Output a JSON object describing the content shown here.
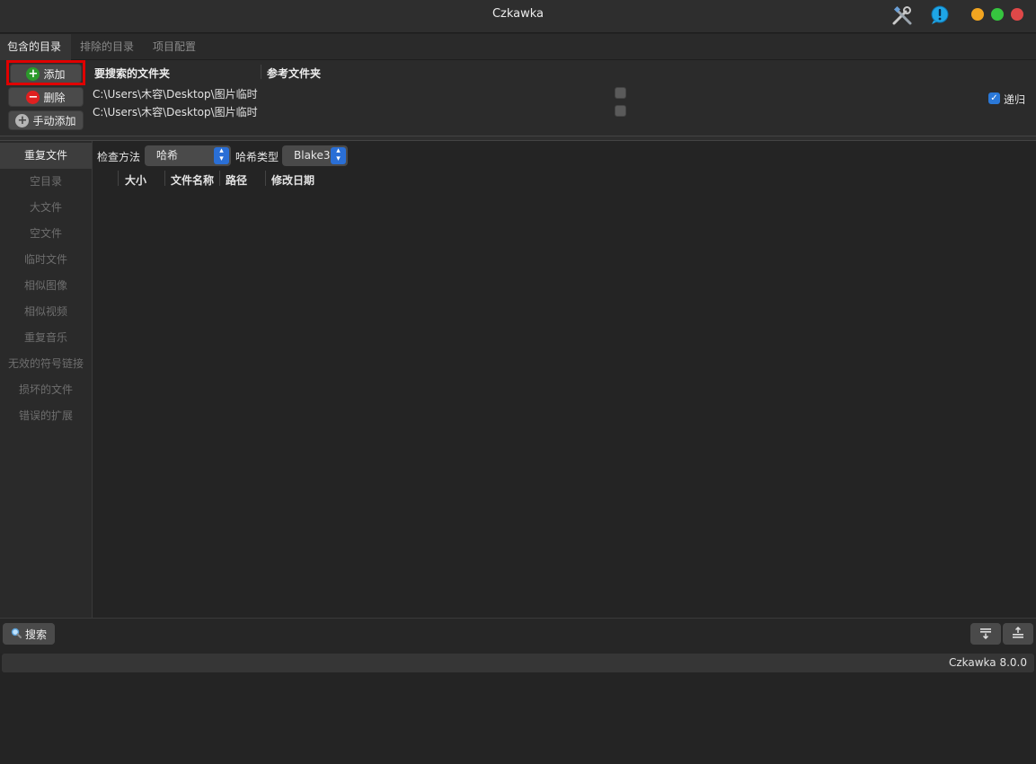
{
  "window": {
    "title": "Czkawka",
    "toolbar_icons": [
      "tools-icon",
      "info-bubble-icon"
    ],
    "controls": [
      {
        "name": "minimize",
        "color": "#f2a520"
      },
      {
        "name": "maximize",
        "color": "#36c53f"
      },
      {
        "name": "close",
        "color": "#e04848"
      }
    ]
  },
  "tabs": [
    {
      "label": "包含的目录",
      "active": true
    },
    {
      "label": "排除的目录",
      "active": false
    },
    {
      "label": "项目配置",
      "active": false
    }
  ],
  "dir_panel": {
    "buttons": [
      {
        "label": "添加",
        "icon": "plus-circle-icon",
        "icon_color": "#2b9a2b",
        "highlighted": true
      },
      {
        "label": "删除",
        "icon": "minus-circle-icon",
        "icon_color": "#e02020"
      },
      {
        "label": "手动添加",
        "icon": "plus-circle-icon",
        "icon_color": "#b5b5b5"
      }
    ],
    "columns": {
      "search": "要搜索的文件夹",
      "reference": "参考文件夹"
    },
    "rows": [
      {
        "path": "C:\\Users\\木容\\Desktop\\图片临时",
        "reference": false
      },
      {
        "path": "C:\\Users\\木容\\Desktop\\图片临时",
        "reference": false
      }
    ],
    "recursive": {
      "label": "递归",
      "checked": true
    }
  },
  "sidebar": {
    "items": [
      {
        "label": "重复文件",
        "active": true
      },
      {
        "label": "空目录"
      },
      {
        "label": "大文件"
      },
      {
        "label": "空文件"
      },
      {
        "label": "临时文件"
      },
      {
        "label": "相似图像"
      },
      {
        "label": "相似视频"
      },
      {
        "label": "重复音乐"
      },
      {
        "label": "无效的符号链接"
      },
      {
        "label": "损坏的文件"
      },
      {
        "label": "错误的扩展"
      }
    ]
  },
  "main": {
    "check_method_label": "检查方法",
    "check_method_value": "哈希",
    "hash_type_label": "哈希类型",
    "hash_type_value": "Blake3",
    "table_headers": [
      "大小",
      "文件名称",
      "路径",
      "修改日期"
    ]
  },
  "bottom": {
    "search_label": "搜索",
    "search_icon": "magnifier-icon",
    "right_icons": [
      "move-down-icon",
      "move-up-icon"
    ]
  },
  "status": {
    "version": "Czkawka 8.0.0"
  }
}
